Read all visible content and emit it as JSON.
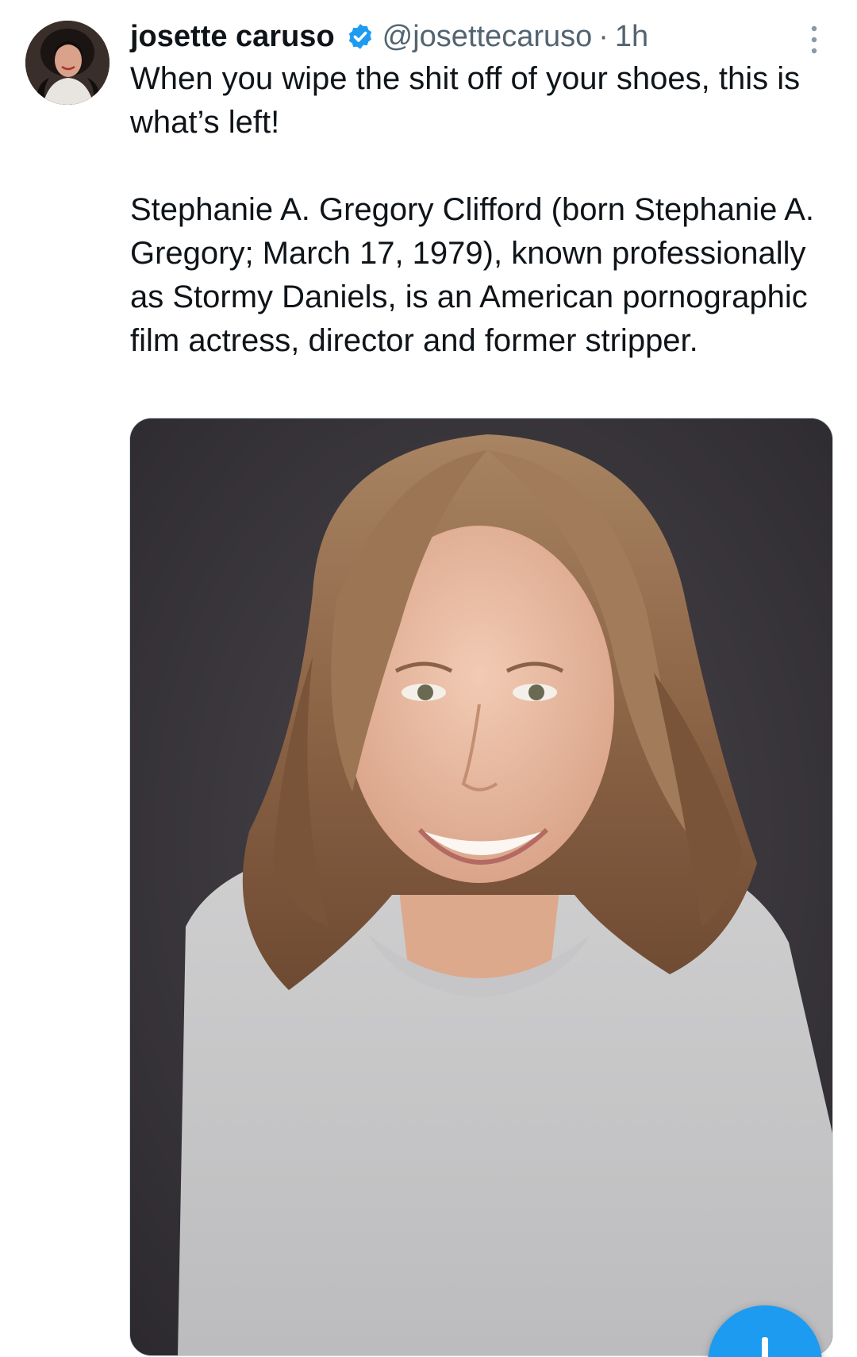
{
  "author": {
    "display_name": "josette caruso",
    "handle": "@josettecaruso",
    "separator": "·",
    "time": "1h",
    "verified_badge_icon": "verified-badge-icon",
    "avatar_icon": "profile-avatar"
  },
  "tweet": {
    "paragraph1": "When you wipe the shit off of your shoes, this is what’s left!",
    "paragraph2": "Stephanie A. Gregory Clifford (born Stephanie A. Gregory; March 17, 1979), known professionally as Stormy Daniels, is an American pornographic film actress, director and former stripper."
  },
  "media": {
    "type": "photo",
    "icon": "portrait-photo"
  },
  "more_menu_icon": "more-vertical-icon",
  "compose_button_icon": "plus-icon",
  "colors": {
    "text": "#0f1419",
    "secondary": "#536471",
    "accent": "#1d9bf0",
    "photo_backdrop": "#37343a"
  }
}
